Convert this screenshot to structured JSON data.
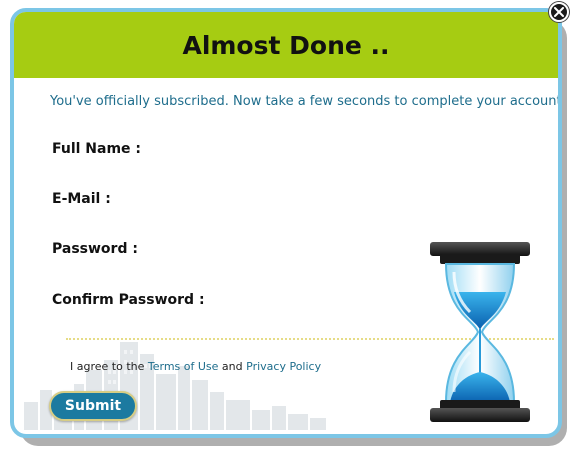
{
  "header": {
    "title": "Almost Done .."
  },
  "subtitle": "You've officially subscribed. Now take a few seconds to complete your account.",
  "form": {
    "fields": [
      {
        "label": "Full Name :"
      },
      {
        "label": "E-Mail :"
      },
      {
        "label": "Password :"
      },
      {
        "label": "Confirm Password :"
      }
    ]
  },
  "agreement": {
    "prefix": "I agree to the ",
    "terms_link": "Terms of Use",
    "middle": " and ",
    "privacy_link": "Privacy Policy"
  },
  "submit_label": "Submit",
  "colors": {
    "header_bg": "#a6cc12",
    "border": "#7cc6e6",
    "accent": "#1e6d8c",
    "button_bg": "#1c7aa0"
  },
  "icons": {
    "close": "close-icon",
    "hourglass": "hourglass-icon",
    "skyline": "city-skyline"
  }
}
